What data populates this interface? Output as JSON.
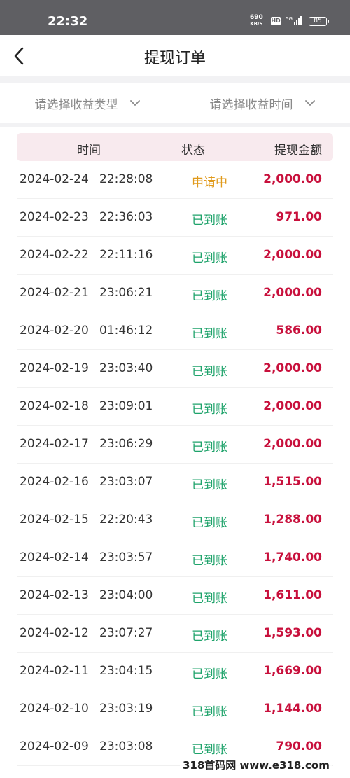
{
  "status_bar": {
    "time": "22:32",
    "net_speed_value": "690",
    "net_speed_unit": "KB/S",
    "hd": "HD",
    "network": "5G",
    "battery": "85"
  },
  "nav": {
    "title": "提现订单"
  },
  "filters": {
    "type_placeholder": "请选择收益类型",
    "time_placeholder": "请选择收益时间"
  },
  "table": {
    "headers": {
      "time": "时间",
      "status": "状态",
      "amount": "提现金额"
    },
    "rows": [
      {
        "date": "2024-02-24",
        "time": "22:28:08",
        "status": "申请中",
        "amount": "2,000.00"
      },
      {
        "date": "2024-02-23",
        "time": "22:36:03",
        "status": "已到账",
        "amount": "971.00"
      },
      {
        "date": "2024-02-22",
        "time": "22:11:16",
        "status": "已到账",
        "amount": "2,000.00"
      },
      {
        "date": "2024-02-21",
        "time": "23:06:21",
        "status": "已到账",
        "amount": "2,000.00"
      },
      {
        "date": "2024-02-20",
        "time": "01:46:12",
        "status": "已到账",
        "amount": "586.00"
      },
      {
        "date": "2024-02-19",
        "time": "23:03:40",
        "status": "已到账",
        "amount": "2,000.00"
      },
      {
        "date": "2024-02-18",
        "time": "23:09:01",
        "status": "已到账",
        "amount": "2,000.00"
      },
      {
        "date": "2024-02-17",
        "time": "23:06:29",
        "status": "已到账",
        "amount": "2,000.00"
      },
      {
        "date": "2024-02-16",
        "time": "23:03:07",
        "status": "已到账",
        "amount": "1,515.00"
      },
      {
        "date": "2024-02-15",
        "time": "22:20:43",
        "status": "已到账",
        "amount": "1,288.00"
      },
      {
        "date": "2024-02-14",
        "time": "23:03:57",
        "status": "已到账",
        "amount": "1,740.00"
      },
      {
        "date": "2024-02-13",
        "time": "23:04:00",
        "status": "已到账",
        "amount": "1,611.00"
      },
      {
        "date": "2024-02-12",
        "time": "23:07:27",
        "status": "已到账",
        "amount": "1,593.00"
      },
      {
        "date": "2024-02-11",
        "time": "23:04:15",
        "status": "已到账",
        "amount": "1,669.00"
      },
      {
        "date": "2024-02-10",
        "time": "23:03:19",
        "status": "已到账",
        "amount": "1,144.00"
      },
      {
        "date": "2024-02-09",
        "time": "23:03:08",
        "status": "已到账",
        "amount": "790.00"
      }
    ]
  },
  "watermark": "318首码网 www.e318.com",
  "colors": {
    "pending": "#e09a1c",
    "done": "#1fa36b",
    "amount": "#c8103c",
    "header_bg": "#f8eaee"
  },
  "icons": {
    "back": "back-arrow-icon",
    "dropdown": "chevron-down-icon"
  }
}
